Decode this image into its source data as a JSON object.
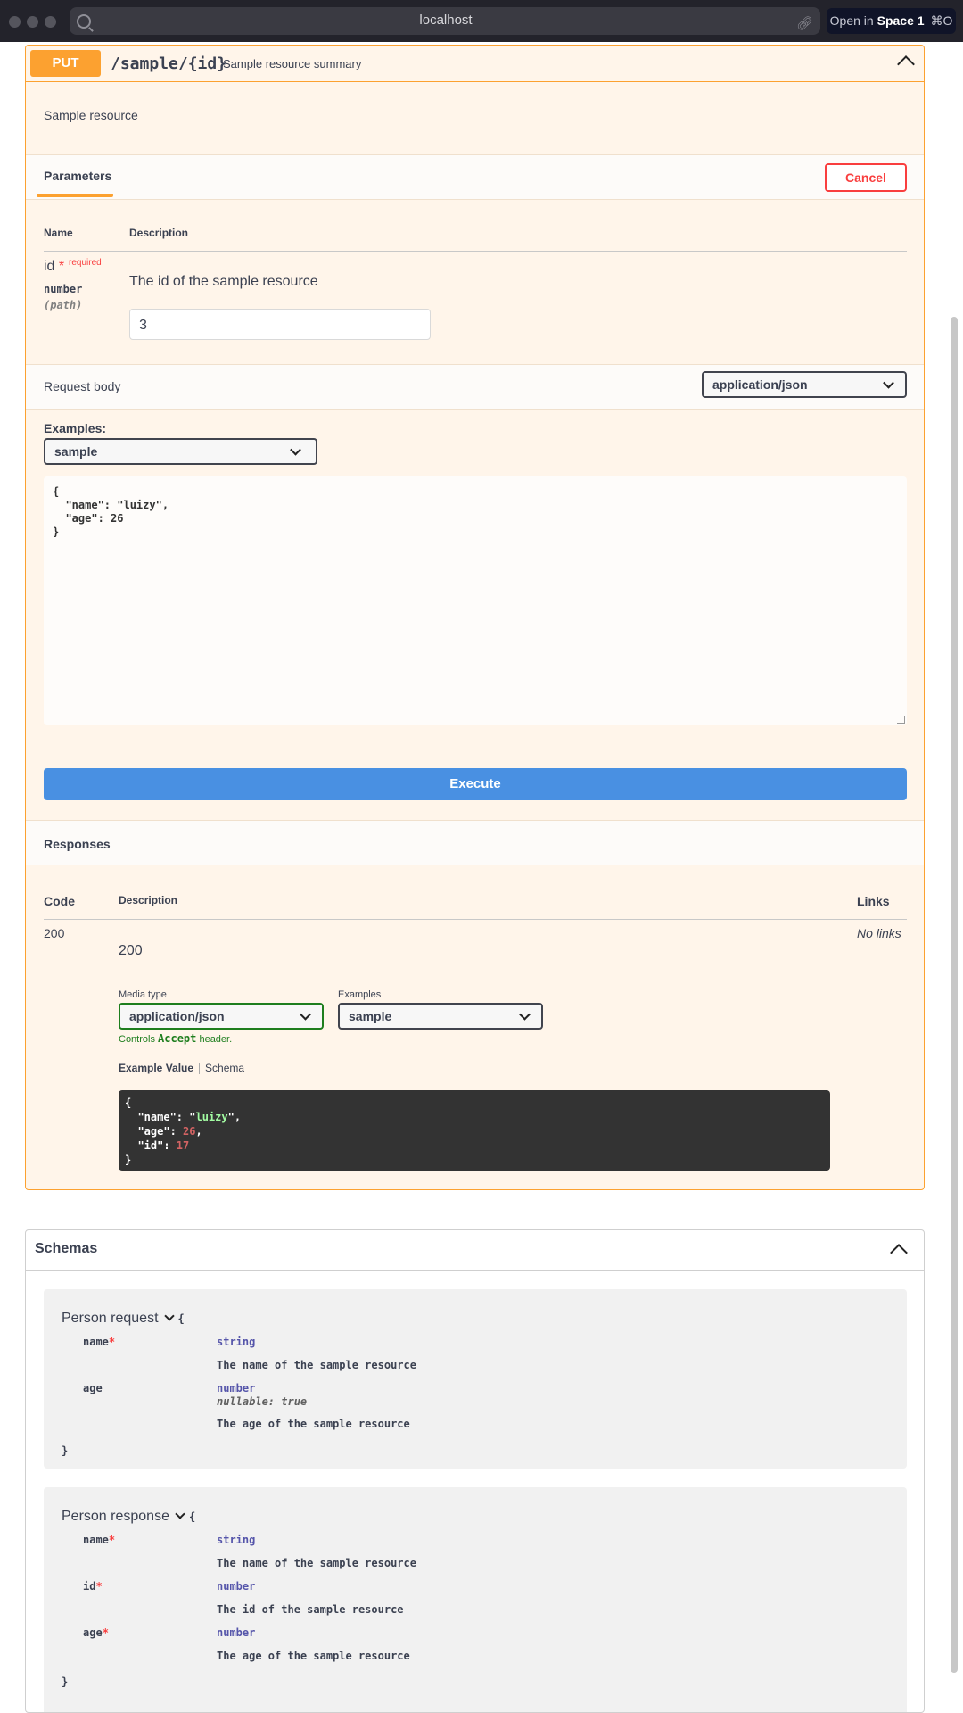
{
  "browser": {
    "url": "localhost",
    "open_in_prefix": "Open in",
    "open_in_space": "Space 1",
    "open_in_shortcut": "⌘O"
  },
  "operation": {
    "method": "PUT",
    "path": "/sample/{id}",
    "summary": "Sample resource summary",
    "description": "Sample resource",
    "method_color": "#fca130"
  },
  "parameters": {
    "tab_label": "Parameters",
    "cancel_label": "Cancel",
    "col_name": "Name",
    "col_description": "Description",
    "items": [
      {
        "name": "id",
        "required_mark": "*",
        "required_label": "required",
        "type": "number",
        "in": "(path)",
        "description": "The id of the sample resource",
        "value": "3"
      }
    ]
  },
  "request_body": {
    "label": "Request body",
    "content_type": "application/json",
    "examples_label": "Examples:",
    "example_selected": "sample",
    "body_text": "{\n  \"name\": \"luizy\",\n  \"age\": 26\n}"
  },
  "execute_label": "Execute",
  "responses": {
    "label": "Responses",
    "col_code": "Code",
    "col_description": "Description",
    "col_links": "Links",
    "items": [
      {
        "code": "200",
        "description": "200",
        "links": "No links",
        "media_type_label": "Media type",
        "media_type": "application/json",
        "examples_label": "Examples",
        "example_selected": "sample",
        "controls_prefix": "Controls",
        "controls_code": "Accept",
        "controls_suffix": "header.",
        "tab_example": "Example Value",
        "tab_schema": "Schema",
        "example": {
          "name": "luizy",
          "age": "26",
          "id": "17"
        }
      }
    ]
  },
  "schemas": {
    "title": "Schemas",
    "models": [
      {
        "title": "Person request",
        "open_brace": "{",
        "close_brace": "}",
        "properties": [
          {
            "name": "name",
            "required": "*",
            "type": "string",
            "nullable": "",
            "description": "The name of the sample resource"
          },
          {
            "name": "age",
            "required": "",
            "type": "number",
            "nullable": "nullable: true",
            "description": "The age of the sample resource"
          }
        ]
      },
      {
        "title": "Person response",
        "open_brace": "{",
        "close_brace": "}",
        "properties": [
          {
            "name": "name",
            "required": "*",
            "type": "string",
            "description": "The name of the sample resource"
          },
          {
            "name": "id",
            "required": "*",
            "type": "number",
            "description": "The id of the sample resource"
          },
          {
            "name": "age",
            "required": "*",
            "type": "number",
            "description": "The age of the sample resource"
          }
        ]
      }
    ]
  },
  "colors": {
    "accent_blue": "#4990e2",
    "danger": "#f93e3e",
    "success_green": "#1e7e1e"
  }
}
